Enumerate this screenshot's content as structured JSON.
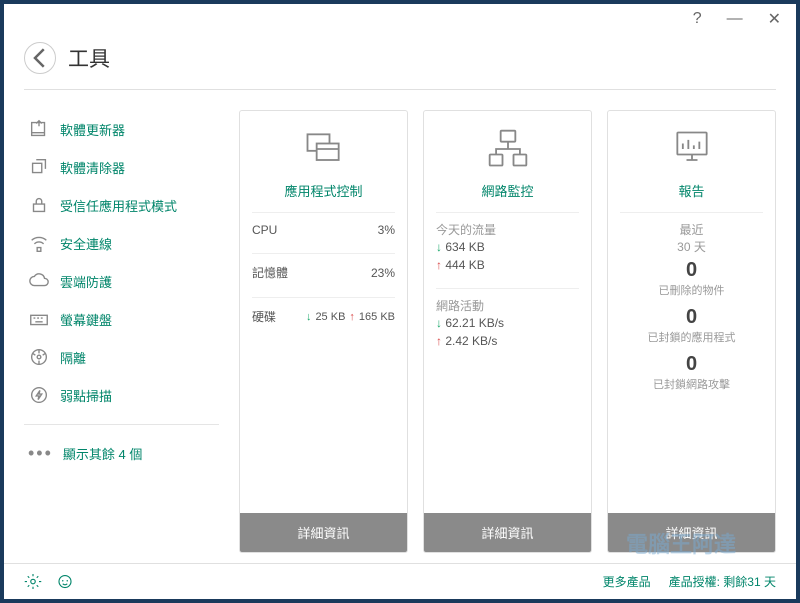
{
  "titlebar": {
    "help": "?",
    "min": "—",
    "close": "✕"
  },
  "header": {
    "title": "工具"
  },
  "sidebar": {
    "items": [
      {
        "label": "軟體更新器"
      },
      {
        "label": "軟體清除器"
      },
      {
        "label": "受信任應用程式模式"
      },
      {
        "label": "安全連線"
      },
      {
        "label": "雲端防護"
      },
      {
        "label": "螢幕鍵盤"
      },
      {
        "label": "隔離"
      },
      {
        "label": "弱點掃描"
      }
    ],
    "more": "顯示其餘 4 個"
  },
  "cards": {
    "app": {
      "title": "應用程式控制",
      "cpu_label": "CPU",
      "cpu_val": "3%",
      "mem_label": "記憶體",
      "mem_val": "23%",
      "disk_label": "硬碟",
      "disk_down": "25 KB",
      "disk_up": "165 KB",
      "details": "詳細資訊"
    },
    "net": {
      "title": "網路監控",
      "today_label": "今天的流量",
      "today_down": "634 KB",
      "today_up": "444 KB",
      "activity_label": "網路活動",
      "act_down": "62.21 KB/s",
      "act_up": "2.42 KB/s",
      "details": "詳細資訊"
    },
    "report": {
      "title": "報告",
      "recent": "最近",
      "days": "30 天",
      "deleted_n": "0",
      "deleted_lbl": "已刪除的物件",
      "blockedapp_n": "0",
      "blockedapp_lbl": "已封鎖的應用程式",
      "blockednet_n": "0",
      "blockednet_lbl": "已封鎖網路攻擊",
      "details": "詳細資訊"
    }
  },
  "footer": {
    "more_products": "更多產品",
    "license": "產品授權: 剩餘31 天"
  },
  "watermark": "電腦王阿達"
}
